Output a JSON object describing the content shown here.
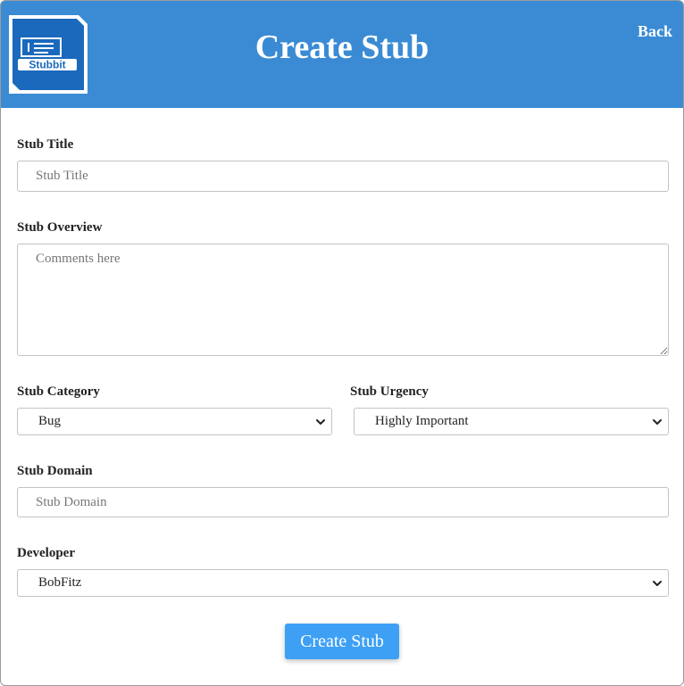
{
  "header": {
    "title": "Create Stub",
    "back_label": "Back",
    "logo_text": "Stubbit",
    "color": "#3a8bd4"
  },
  "form": {
    "title_label": "Stub Title",
    "title_placeholder": "Stub Title",
    "overview_label": "Stub Overview",
    "overview_placeholder": "Comments here",
    "category_label": "Stub Category",
    "category_value": "Bug",
    "urgency_label": "Stub Urgency",
    "urgency_value": "Highly Important",
    "domain_label": "Stub Domain",
    "domain_placeholder": "Stub Domain",
    "developer_label": "Developer",
    "developer_value": "BobFitz"
  },
  "submit": {
    "label": "Create Stub",
    "color": "#3da0f5"
  },
  "icons": {
    "logo": "stubbit-logo",
    "dropdown": "chevron-down-icon"
  }
}
